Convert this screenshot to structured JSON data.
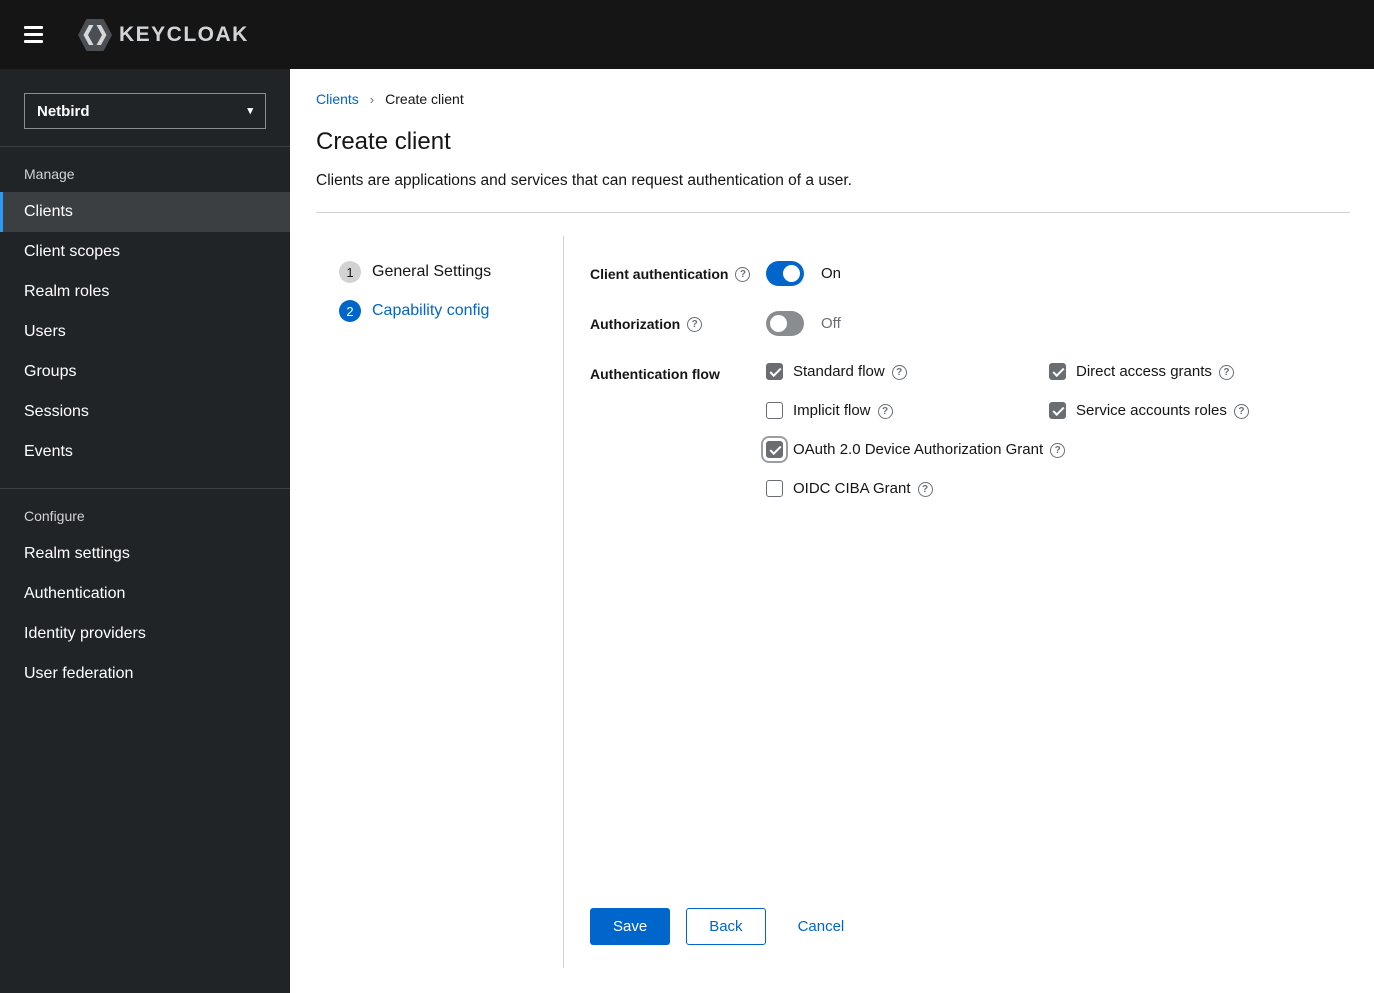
{
  "masthead": {
    "brand": "KEYCLOAK"
  },
  "icons": {
    "help": "?",
    "caret_down": "▾",
    "breadcrumb_separator": "›"
  },
  "sidebar": {
    "realm_selector": {
      "value": "Netbird"
    },
    "sections": [
      {
        "title": "Manage",
        "items": [
          {
            "label": "Clients",
            "selected": true
          },
          {
            "label": "Client scopes",
            "selected": false
          },
          {
            "label": "Realm roles",
            "selected": false
          },
          {
            "label": "Users",
            "selected": false
          },
          {
            "label": "Groups",
            "selected": false
          },
          {
            "label": "Sessions",
            "selected": false
          },
          {
            "label": "Events",
            "selected": false
          }
        ]
      },
      {
        "title": "Configure",
        "items": [
          {
            "label": "Realm settings",
            "selected": false
          },
          {
            "label": "Authentication",
            "selected": false
          },
          {
            "label": "Identity providers",
            "selected": false
          },
          {
            "label": "User federation",
            "selected": false
          }
        ]
      }
    ]
  },
  "breadcrumb": {
    "root": "Clients",
    "current": "Create client"
  },
  "page": {
    "title": "Create client",
    "description": "Clients are applications and services that can request authentication of a user."
  },
  "wizard": {
    "steps": [
      {
        "number": "1",
        "label": "General Settings",
        "current": false
      },
      {
        "number": "2",
        "label": "Capability config",
        "current": true
      }
    ]
  },
  "form": {
    "client_authentication": {
      "label": "Client authentication",
      "state": "On",
      "on": true
    },
    "authorization": {
      "label": "Authorization",
      "state": "Off",
      "on": false
    },
    "authentication_flow": {
      "label": "Authentication flow",
      "options": [
        {
          "label": "Standard flow",
          "checked": true,
          "focused": false
        },
        {
          "label": "Direct access grants",
          "checked": true,
          "focused": false
        },
        {
          "label": "Implicit flow",
          "checked": false,
          "focused": false
        },
        {
          "label": "Service accounts roles",
          "checked": true,
          "focused": false
        },
        {
          "label": "OAuth 2.0 Device Authorization Grant",
          "checked": true,
          "focused": true
        },
        {
          "label": "OIDC CIBA Grant",
          "checked": false,
          "focused": false
        }
      ]
    }
  },
  "actions": {
    "save": "Save",
    "back": "Back",
    "cancel": "Cancel"
  },
  "colors": {
    "accent": "#0066cc",
    "masthead_bg": "#151515",
    "sidebar_bg": "#212427",
    "nav_selected_bg": "#3c3f42",
    "nav_accent": "#2b9af3",
    "checkbox_checked": "#6a6e73",
    "divider": "#d2d2d2"
  }
}
